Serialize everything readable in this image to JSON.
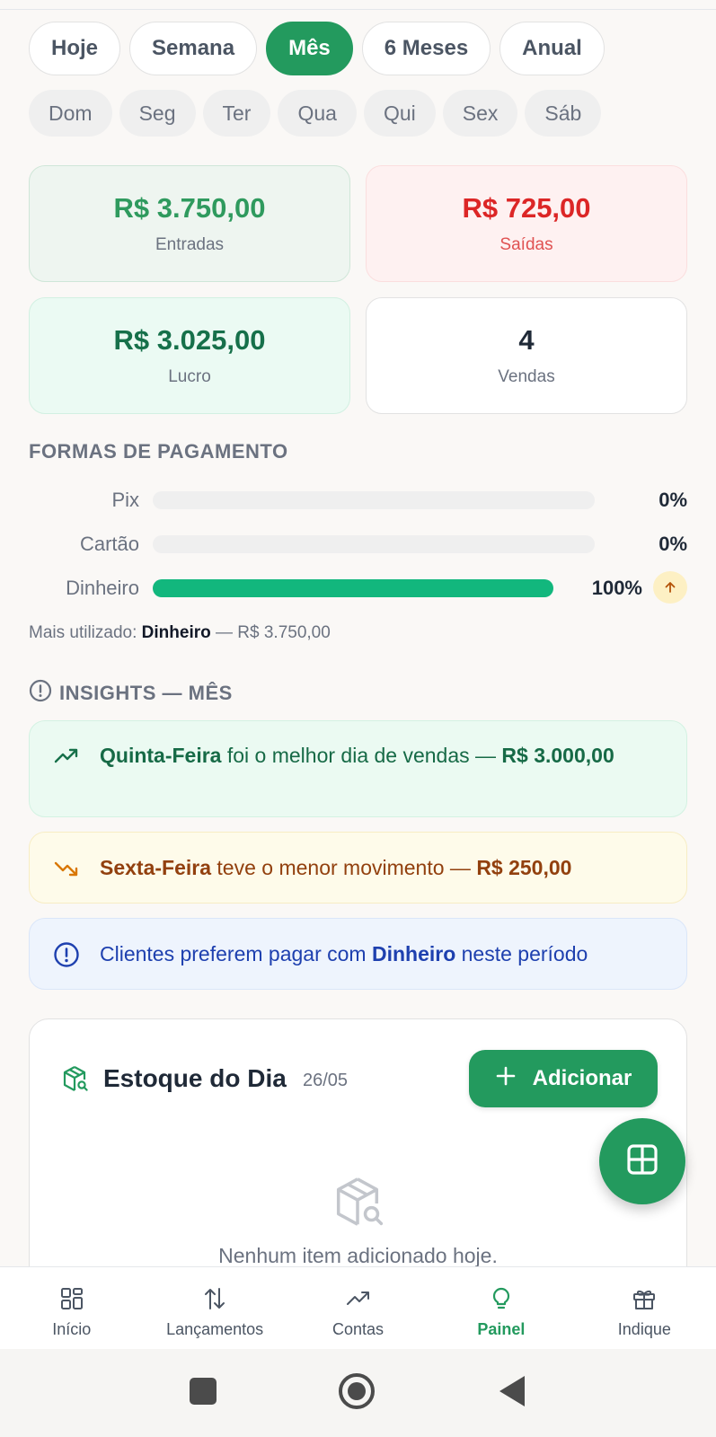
{
  "periods": [
    {
      "label": "Hoje",
      "active": false
    },
    {
      "label": "Semana",
      "active": false
    },
    {
      "label": "Mês",
      "active": true
    },
    {
      "label": "6 Meses",
      "active": false
    },
    {
      "label": "Anual",
      "active": false
    }
  ],
  "days": [
    "Dom",
    "Seg",
    "Ter",
    "Qua",
    "Qui",
    "Sex",
    "Sáb"
  ],
  "stats": {
    "entradas": {
      "value": "R$ 3.750,00",
      "label": "Entradas"
    },
    "saidas": {
      "value": "R$ 725,00",
      "label": "Saídas"
    },
    "lucro": {
      "value": "R$ 3.025,00",
      "label": "Lucro"
    },
    "vendas": {
      "value": "4",
      "label": "Vendas"
    }
  },
  "payments": {
    "title": "FORMAS DE PAGAMENTO",
    "rows": [
      {
        "name": "Pix",
        "percent": 0,
        "percent_label": "0%"
      },
      {
        "name": "Cartão",
        "percent": 0,
        "percent_label": "0%"
      },
      {
        "name": "Dinheiro",
        "percent": 100,
        "percent_label": "100%"
      }
    ],
    "most_used_prefix": "Mais utilizado:",
    "most_used_method": "Dinheiro",
    "most_used_value": "— R$ 3.750,00"
  },
  "insights": {
    "title": "INSIGHTS — MÊS",
    "best": {
      "day": "Quinta-Feira",
      "text": " foi o melhor dia de vendas — ",
      "value": "R$ 3.000,00"
    },
    "worst": {
      "day": "Sexta-Feira",
      "text": " teve o menor movimento — ",
      "value": "R$ 250,00"
    },
    "preference": {
      "text_before": "Clientes preferem pagar com ",
      "method": "Dinheiro",
      "text_after": " neste período"
    }
  },
  "stock": {
    "title": "Estoque do Dia",
    "date": "26/05",
    "add_label": "Adicionar",
    "empty_text": "Nenhum item adicionado hoje."
  },
  "nav": [
    {
      "label": "Início",
      "icon": "grid-icon",
      "active": false
    },
    {
      "label": "Lançamentos",
      "icon": "arrows-updown-icon",
      "active": false
    },
    {
      "label": "Contas",
      "icon": "trending-up-icon",
      "active": false
    },
    {
      "label": "Painel",
      "icon": "lightbulb-icon",
      "active": true
    },
    {
      "label": "Indique",
      "icon": "gift-icon",
      "active": false
    }
  ],
  "colors": {
    "brand": "#239a5e",
    "income": "#2f9a5e",
    "expense": "#dc2626",
    "progress": "#12b77d"
  }
}
